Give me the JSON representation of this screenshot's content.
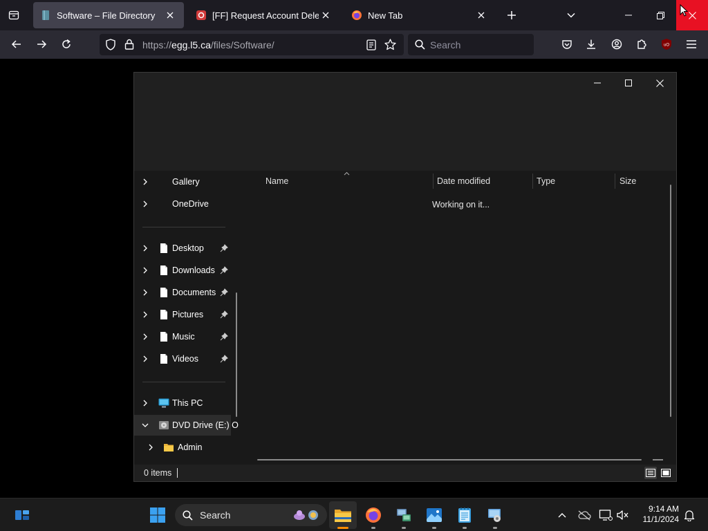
{
  "browser": {
    "tabs": [
      {
        "title": "Software – File Directory",
        "active": true
      },
      {
        "title": "[FF] Request Account Deletion",
        "active": false
      },
      {
        "title": "New Tab",
        "active": false
      }
    ],
    "url_prefix": "https://",
    "url_host": "egg.l5.ca",
    "url_path": "/files/Software/",
    "search_placeholder": "Search"
  },
  "explorer": {
    "nav_pane": {
      "top_items": [
        {
          "label": "Gallery",
          "icon": "gallery-icon"
        },
        {
          "label": "OneDrive",
          "icon": "onedrive-icon"
        }
      ],
      "quick_access": [
        {
          "label": "Desktop",
          "pinned": true
        },
        {
          "label": "Downloads",
          "pinned": true
        },
        {
          "label": "Documents",
          "pinned": true
        },
        {
          "label": "Pictures",
          "pinned": true
        },
        {
          "label": "Music",
          "pinned": true
        },
        {
          "label": "Videos",
          "pinned": true
        }
      ],
      "this_pc": "This PC",
      "dvd_drive": "DVD Drive (E:) O",
      "dvd_child": "Admin"
    },
    "columns": [
      "Name",
      "Date modified",
      "Type",
      "Size"
    ],
    "status_message": "Working on it...",
    "item_count": "0 items"
  },
  "taskbar": {
    "search_label": "Search",
    "time": "9:14 AM",
    "date": "11/1/2024",
    "apps": [
      "file-explorer-icon",
      "firefox-icon",
      "network-app-icon",
      "photos-app-icon",
      "notepad-icon",
      "remote-desktop-icon"
    ]
  },
  "colors": {
    "firefox_close_hover": "#e81123",
    "taskbar_active_indicator": "#ff8c00",
    "windows_blue": "#0078d4",
    "folder_yellow": "#f7c948"
  }
}
